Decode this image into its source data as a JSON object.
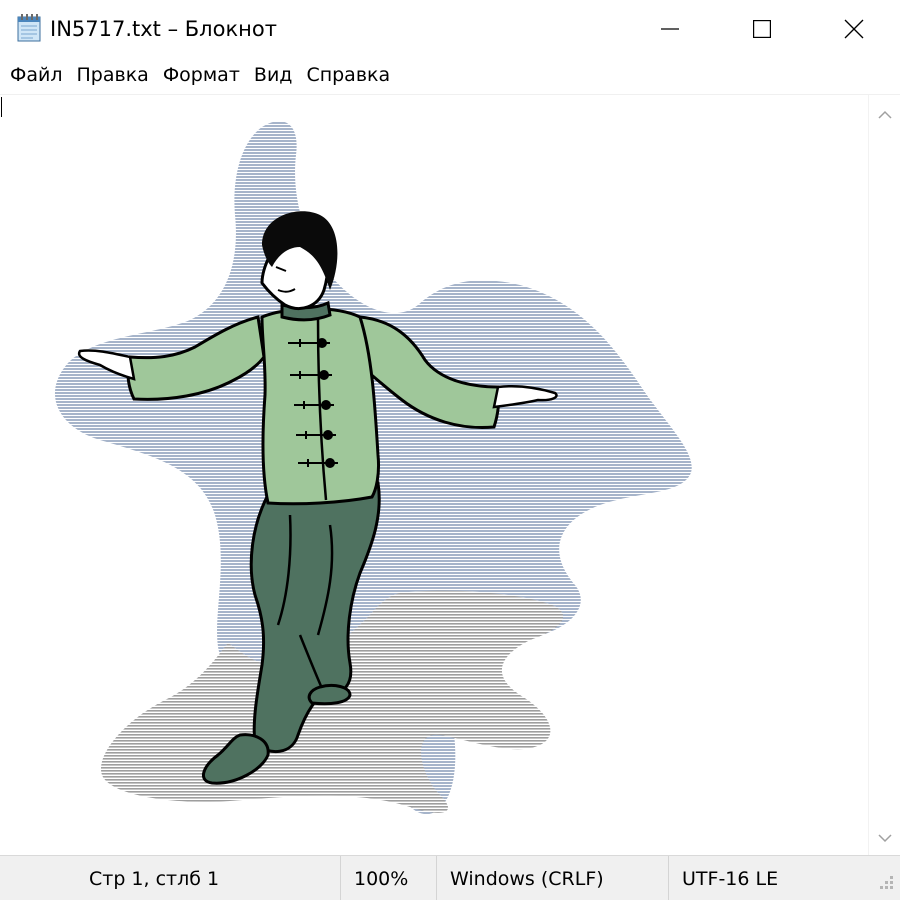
{
  "window": {
    "title": "IN5717.txt – Блокнот",
    "icon": "notepad-icon",
    "controls": {
      "minimize_icon": "minimize-icon",
      "maximize_icon": "maximize-icon",
      "close_icon": "close-icon"
    }
  },
  "menu": {
    "items": [
      {
        "label": "Файл"
      },
      {
        "label": "Правка"
      },
      {
        "label": "Формат"
      },
      {
        "label": "Вид"
      },
      {
        "label": "Справка"
      }
    ]
  },
  "editor": {
    "illustration": "tai-chi-figure",
    "colors": {
      "splash": "#a6b4ca",
      "shadow": "#a8a8a8",
      "shirt": "#9fc79a",
      "pants": "#4f7260",
      "outline": "#000000",
      "skin": "#ffffff",
      "hair": "#0a0a0a"
    }
  },
  "scrollbar": {
    "up_icon": "chevron-up-icon",
    "down_icon": "chevron-down-icon"
  },
  "status": {
    "position": "Стр 1, стлб 1",
    "zoom": "100%",
    "line_endings": "Windows (CRLF)",
    "encoding": "UTF-16 LE"
  }
}
